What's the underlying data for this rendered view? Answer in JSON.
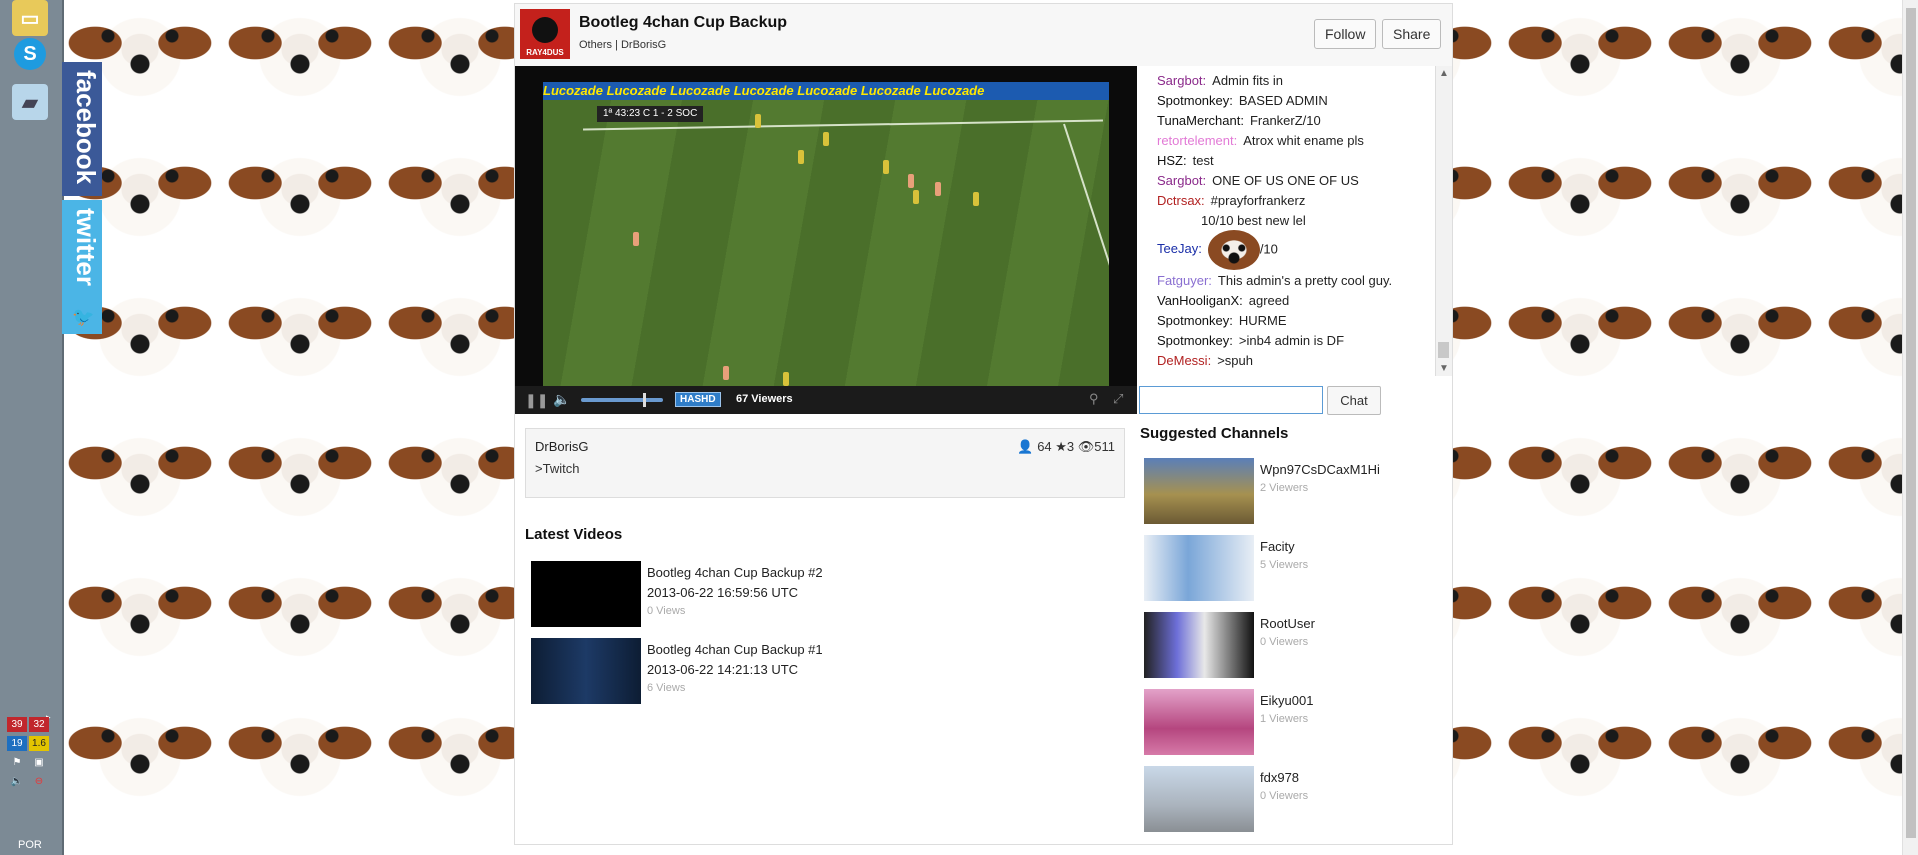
{
  "taskbar": {
    "tray": [
      {
        "text": "39",
        "color": "#c1272d"
      },
      {
        "text": "32",
        "color": "#c1272d"
      },
      {
        "text": "19",
        "color": "#1e6fc0"
      },
      {
        "text": "1.6",
        "color": "#e3c400"
      }
    ],
    "language": "POR"
  },
  "social": {
    "facebook": "facebook",
    "twitter": "twitter"
  },
  "header": {
    "logo_text": "RAY4DUS",
    "title": "Bootleg 4chan Cup Backup",
    "meta": "Others | DrBorisG",
    "follow_label": "Follow",
    "share_label": "Share"
  },
  "video": {
    "board_text": "Lucozade   Lucozade   Lucozade   Lucozade   Lucozade   Lucozade   Lucozade",
    "score_text": "1ª  43:23   C  1 - 2  SOC",
    "badge": "HASHD",
    "viewers": "67 Viewers"
  },
  "info": {
    "user": "DrBorisG",
    "stats": "👤 64 ★3 👁511",
    "desc": ">Twitch"
  },
  "latest": {
    "title": "Latest Videos",
    "items": [
      {
        "title": "Bootleg 4chan Cup Backup #2",
        "date": "2013-06-22 16:59:56 UTC",
        "views": "0 Views"
      },
      {
        "title": "Bootleg 4chan Cup Backup #1",
        "date": "2013-06-22 14:21:13 UTC",
        "views": "6 Views"
      }
    ]
  },
  "chat": {
    "lines": [
      {
        "name": "Sargbot:",
        "color": "#8b2a8b",
        "msg": "Admin fits in"
      },
      {
        "name": "Spotmonkey:",
        "color": "#111111",
        "msg": "BASED ADMIN"
      },
      {
        "name": "TunaMerchant:",
        "color": "#111111",
        "msg": "FrankerZ/10"
      },
      {
        "name": "retortelement:",
        "color": "#e27ad6",
        "msg": "Atrox whit ename pls"
      },
      {
        "name": "HSZ:",
        "color": "#111111",
        "msg": "test"
      },
      {
        "name": "Sargbot:",
        "color": "#8b2a8b",
        "msg": "ONE OF US ONE OF US"
      },
      {
        "name": "Dctrsax:",
        "color": "#b22222",
        "msg": "#prayforfrankerz"
      },
      {
        "name": "",
        "color": "#111111",
        "msg": "10/10 best new lel"
      },
      {
        "name": "TeeJay:",
        "color": "#1a2ea8",
        "msg": "/10"
      },
      {
        "name": "Fatguyer:",
        "color": "#8a6fd1",
        "msg": "This admin's a pretty cool guy."
      },
      {
        "name": "VanHooliganX:",
        "color": "#111111",
        "msg": "agreed"
      },
      {
        "name": "Spotmonkey:",
        "color": "#111111",
        "msg": "HURME"
      },
      {
        "name": "Spotmonkey:",
        "color": "#111111",
        "msg": ">inb4 admin is DF"
      },
      {
        "name": "DeMessi:",
        "color": "#b22222",
        "msg": ">spuh"
      }
    ],
    "input_value": "",
    "send_label": "Chat"
  },
  "suggested": {
    "title": "Suggested Channels",
    "items": [
      {
        "name": "Wpn97CsDCaxM1Hi",
        "viewers": "2 Viewers"
      },
      {
        "name": "Facity",
        "viewers": "5 Viewers"
      },
      {
        "name": "RootUser",
        "viewers": "0 Viewers"
      },
      {
        "name": "Eikyu001",
        "viewers": "1 Viewers"
      },
      {
        "name": "fdx978",
        "viewers": "0 Viewers"
      }
    ]
  }
}
